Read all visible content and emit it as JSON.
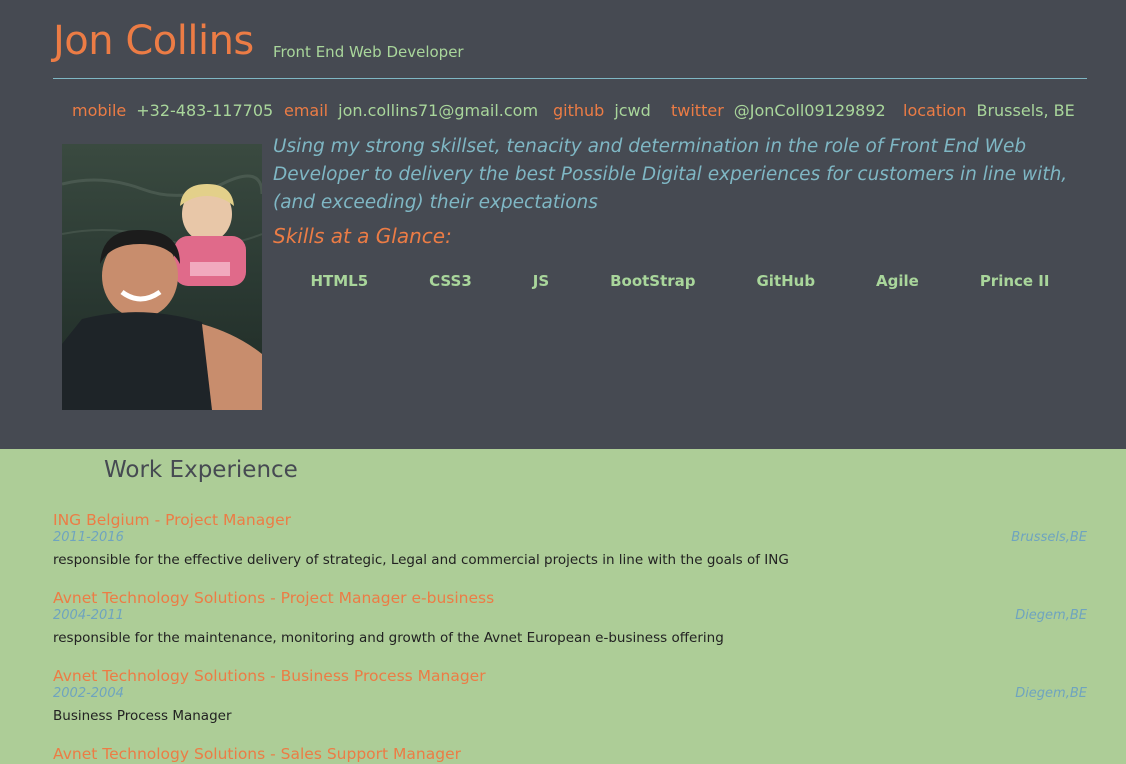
{
  "header": {
    "name": "Jon Collins",
    "role": "Front End Web Developer"
  },
  "contact": [
    {
      "label": "mobile",
      "value": "+32-483-117705"
    },
    {
      "label": "email",
      "value": "jon.collins71@gmail.com"
    },
    {
      "label": "github",
      "value": "jcwd"
    },
    {
      "label": "twitter",
      "value": "@JonColl09129892"
    },
    {
      "label": "location",
      "value": "Brussels, BE"
    }
  ],
  "intro": "Using my strong skillset, tenacity and determination in the role of Front End Web Developer to delivery the best Possible Digital experiences for customers in line with, (and exceeding) their expectations",
  "skills": {
    "title": "Skills at a Glance:",
    "items": [
      "HTML5",
      "CSS3",
      "JS",
      "BootStrap",
      "GitHub",
      "Agile",
      "Prince II"
    ]
  },
  "work": {
    "title": "Work Experience",
    "jobs": [
      {
        "title": "ING Belgium - Project Manager",
        "dates": "2011-2016",
        "location": "Brussels,BE",
        "description": "responsible for the effective delivery of strategic, Legal and commercial projects in line with the goals of ING"
      },
      {
        "title": "Avnet Technology Solutions - Project Manager e-business",
        "dates": "2004-2011",
        "location": "Diegem,BE",
        "description": "responsible for the maintenance, monitoring and growth of the Avnet European e-business offering"
      },
      {
        "title": "Avnet Technology Solutions - Business Process Manager",
        "dates": "2002-2004",
        "location": "Diegem,BE",
        "description": "Business Process Manager"
      },
      {
        "title": "Avnet Technology Solutions - Sales Support Manager",
        "dates": "",
        "location": "",
        "description": ""
      }
    ]
  },
  "colors": {
    "header_bg": "#464a52",
    "accent_orange": "#ec7c45",
    "accent_green": "#a9d69b",
    "accent_blue": "#7fb7c4",
    "work_bg": "#adcd97"
  }
}
